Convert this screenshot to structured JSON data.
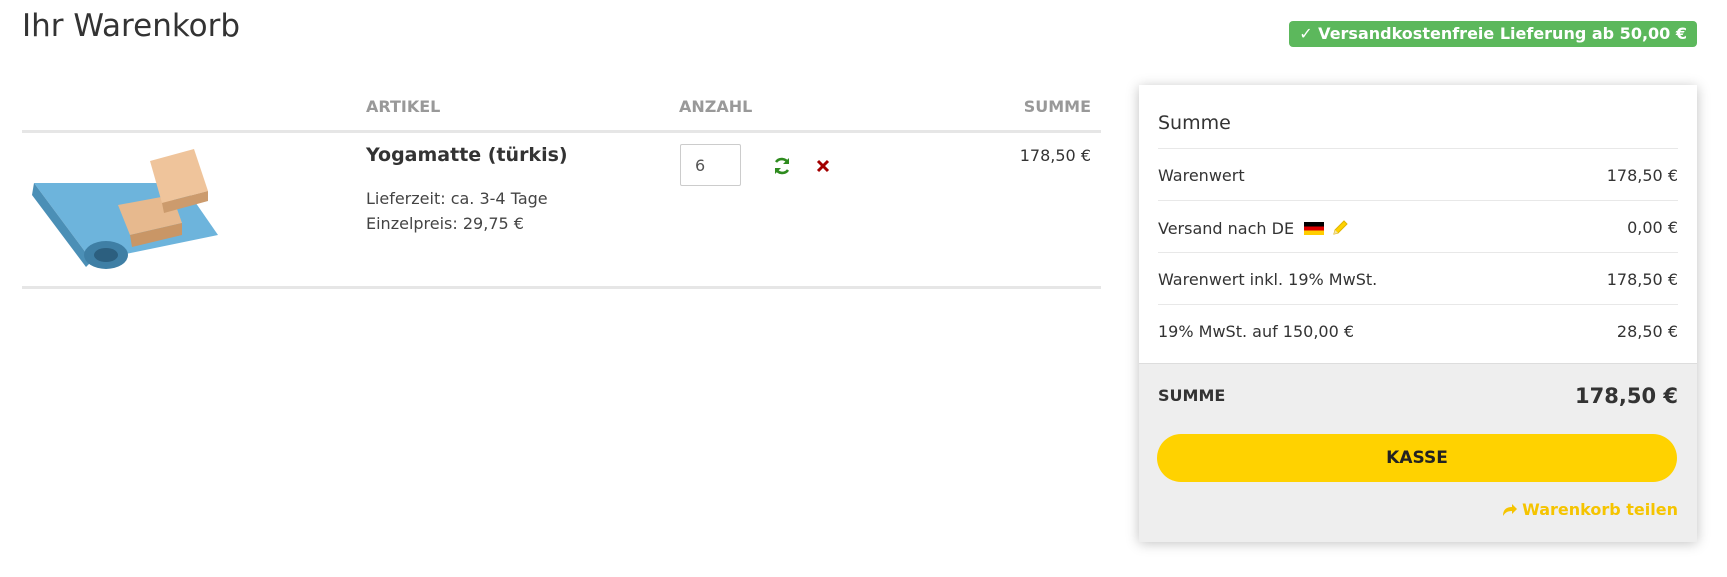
{
  "page": {
    "title": "Ihr Warenkorb"
  },
  "badge": {
    "text": "✓ Versandkostenfreie Lieferung ab 50,00 €",
    "color": "#5cb85c"
  },
  "cart": {
    "headers": {
      "article": "ARTIKEL",
      "quantity": "ANZAHL",
      "sum": "SUMME"
    },
    "items": [
      {
        "name": "Yogamatte (türkis)",
        "delivery": "Lieferzeit: ca. 3-4 Tage",
        "unit_price": "Einzelpreis: 29,75 €",
        "quantity": "6",
        "sum": "178,50 €",
        "image": "yoga-mat-with-blocks"
      }
    ],
    "icons": {
      "refresh": "refresh-icon",
      "remove": "remove-icon"
    }
  },
  "summary": {
    "title": "Summe",
    "rows": [
      {
        "label": "Warenwert",
        "value": "178,50 €"
      },
      {
        "label": "Versand nach DE",
        "value": "0,00 €"
      },
      {
        "label": "Warenwert inkl. 19% MwSt.",
        "value": "178,50 €"
      },
      {
        "label": "19% MwSt. auf 150,00 €",
        "value": "28,50 €"
      }
    ],
    "total_label": "SUMME",
    "total_value": "178,50 €",
    "checkout_label": "KASSE",
    "share_label": "Warenkorb teilen",
    "accent_color": "#ffd200"
  }
}
